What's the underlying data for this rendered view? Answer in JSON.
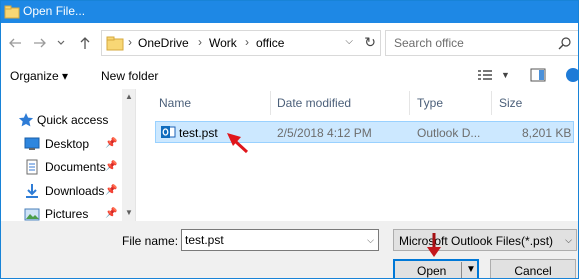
{
  "window": {
    "title": "Open File..."
  },
  "address_bar": {
    "breadcrumbs": [
      "OneDrive",
      "Work",
      "office"
    ],
    "separator": "›"
  },
  "search": {
    "placeholder": "Search office"
  },
  "command_bar": {
    "organize_label": "Organize ▾",
    "new_folder_label": "New folder"
  },
  "nav_pane": {
    "items": [
      {
        "label": "Quick access",
        "icon": "star-icon"
      },
      {
        "label": "Desktop",
        "icon": "desktop-icon",
        "pinned": true
      },
      {
        "label": "Documents",
        "icon": "documents-icon",
        "pinned": true
      },
      {
        "label": "Downloads",
        "icon": "downloads-icon",
        "pinned": true
      },
      {
        "label": "Pictures",
        "icon": "pictures-icon",
        "pinned": true
      }
    ]
  },
  "file_list": {
    "columns": [
      "Name",
      "Date modified",
      "Type",
      "Size"
    ],
    "rows": [
      {
        "name": "test.pst",
        "date_modified": "2/5/2018 4:12 PM",
        "type": "Outlook D...",
        "size": "8,201 KB",
        "selected": true
      }
    ]
  },
  "bottom": {
    "file_name_label": "File name:",
    "file_name_value": "test.pst",
    "file_type_value": "Microsoft Outlook Files(*.pst)",
    "open_label": "Open",
    "cancel_label": "Cancel"
  },
  "colors": {
    "titlebar": "#1e88e5",
    "selection": "#cce8ff",
    "annotation_arrow": "#e0161c"
  }
}
